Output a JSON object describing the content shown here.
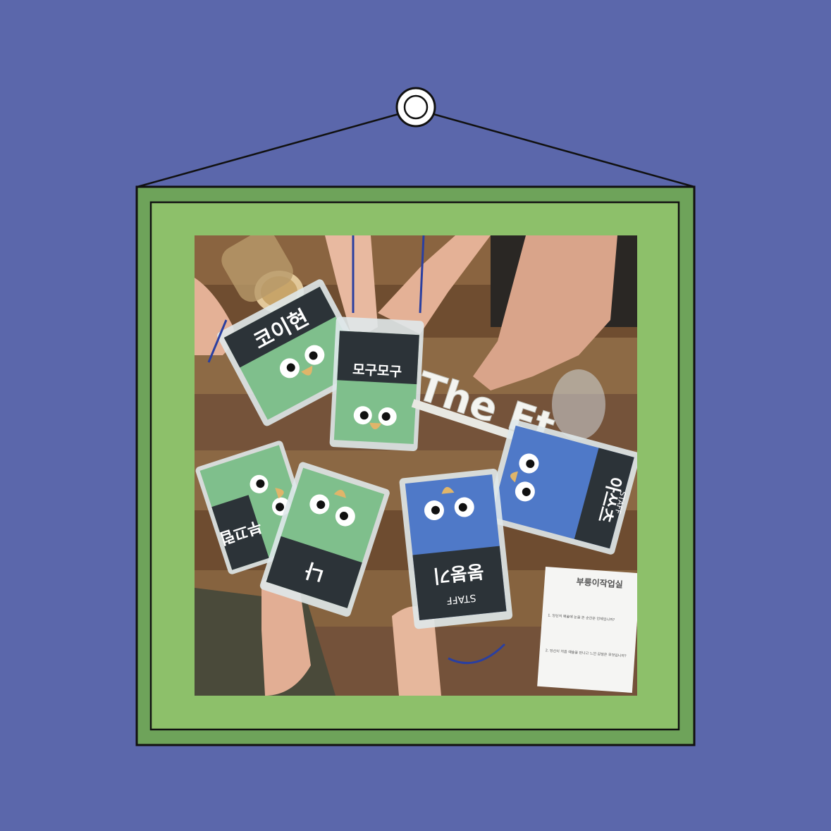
{
  "colors": {
    "background": "#5b67ab",
    "frame_outer": "#6ea35a",
    "frame_inner": "#8dc06a",
    "outline": "#111111"
  },
  "sign": {
    "text": "The Et"
  },
  "badges": [
    {
      "name": "코이현",
      "theme": "green",
      "label": ""
    },
    {
      "name": "모구모구",
      "theme": "green",
      "label": ""
    },
    {
      "name": "아쓰츠",
      "theme": "blue",
      "label": "STAFF"
    },
    {
      "name": "부끄럽",
      "theme": "green",
      "label": ""
    },
    {
      "name": "나",
      "theme": "green",
      "label": ""
    },
    {
      "name": "붕붕기",
      "theme": "blue",
      "label": "STAFF"
    }
  ],
  "paper": {
    "title": "부릉이작업실",
    "q1": "1. 당신의 예술에 눈을 뜬 순간은 언제입니까?",
    "q2": "2. 당신이 처음 예술을 만나고 느낀 감정은 무엇입니까?"
  }
}
